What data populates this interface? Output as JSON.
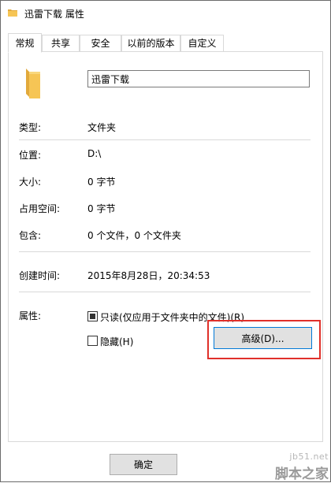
{
  "window": {
    "title": "迅雷下载 属性"
  },
  "tabs": [
    {
      "label": "常规",
      "active": true
    },
    {
      "label": "共享",
      "active": false
    },
    {
      "label": "安全",
      "active": false
    },
    {
      "label": "以前的版本",
      "active": false
    },
    {
      "label": "自定义",
      "active": false
    }
  ],
  "general": {
    "folder_name": "迅雷下载",
    "type_label": "类型:",
    "type_value": "文件夹",
    "location_label": "位置:",
    "location_value": "D:\\",
    "size_label": "大小:",
    "size_value": "0 字节",
    "size_on_disk_label": "占用空间:",
    "size_on_disk_value": "0 字节",
    "contains_label": "包含:",
    "contains_value": "0 个文件，0 个文件夹",
    "created_label": "创建时间:",
    "created_value": "2015年8月28日，20:34:53",
    "attributes_label": "属性:",
    "readonly_label": "只读(仅应用于文件夹中的文件)(R)",
    "readonly_state": "indeterminate",
    "hidden_label": "隐藏(H)",
    "hidden_checked": false,
    "advanced_button": "高级(D)..."
  },
  "footer": {
    "ok_button": "确定"
  },
  "watermark": {
    "line1": "jb51.net",
    "line2": "脚本之家"
  },
  "colors": {
    "folder": "#f6c555",
    "highlight": "#e0302a",
    "accent": "#0078d7"
  }
}
